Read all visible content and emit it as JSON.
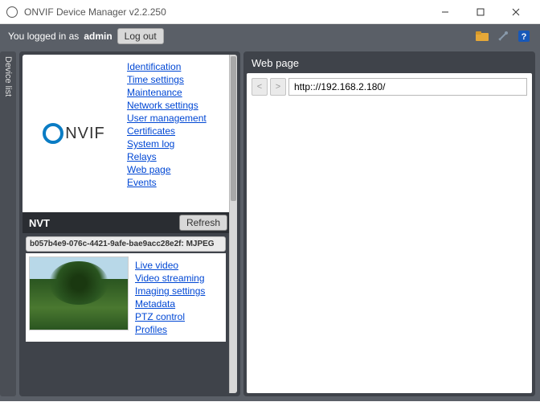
{
  "window": {
    "title": "ONVIF Device Manager v2.2.250"
  },
  "header": {
    "logged_in_text": "You logged in as",
    "username": "admin",
    "logout_label": "Log out"
  },
  "sidebar_tab": {
    "label": "Device list"
  },
  "device": {
    "logo_text": "NVIF",
    "menu": {
      "identification": "Identification",
      "time_settings": "Time settings",
      "maintenance": "Maintenance",
      "network_settings": "Network settings",
      "user_management": "User management",
      "certificates": "Certificates",
      "system_log": "System log",
      "relays": "Relays",
      "web_page": "Web page",
      "events": "Events"
    },
    "nvt_label": "NVT",
    "refresh_label": "Refresh",
    "device_id": "b057b4e9-076c-4421-9afe-bae9acc28e2f: MJPEG",
    "stream_menu": {
      "live_video": "Live video",
      "video_streaming": "Video streaming",
      "imaging_settings": "Imaging settings",
      "metadata": "Metadata",
      "ptz_control": "PTZ control",
      "profiles": "Profiles"
    }
  },
  "webpage": {
    "panel_title": "Web page",
    "nav_back": "<",
    "nav_forward": ">",
    "url": "http:://192.168.2.180/"
  }
}
